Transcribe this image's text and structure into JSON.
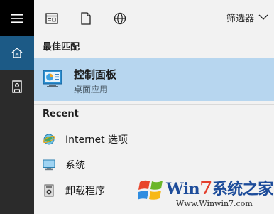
{
  "toolbar": {
    "filter_label": "筛选器"
  },
  "best_match": {
    "header": "最佳匹配",
    "title": "控制面板",
    "subtitle": "桌面应用"
  },
  "recent": {
    "header": "Recent",
    "items": [
      {
        "label": "Internet 选项",
        "icon": "internet-options-icon"
      },
      {
        "label": "系统",
        "icon": "system-monitor-icon"
      },
      {
        "label": "卸载程序",
        "icon": "uninstall-program-icon"
      }
    ]
  },
  "watermark": {
    "brand_prefix": "Win",
    "brand_seven": "7",
    "brand_suffix": "系统之家",
    "url": "Www.Winwin7.com"
  },
  "colors": {
    "rail": "#2b2b2b",
    "rail_active": "#1c5a86",
    "highlight": "#b7d6ef"
  }
}
